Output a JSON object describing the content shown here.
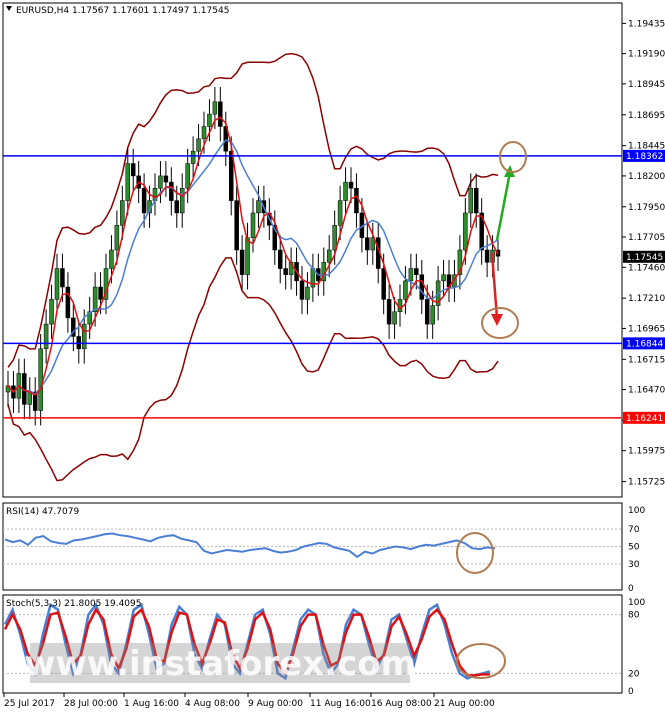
{
  "chart_data": {
    "type": "candlestick",
    "symbol_header": "EURUSD,H4  1.17567 1.17601 1.17497 1.17545",
    "ylim": [
      1.156,
      1.196
    ],
    "y_ticks": [
      "1.19435",
      "1.19190",
      "1.18945",
      "1.18695",
      "1.18445",
      "1.18200",
      "1.17950",
      "1.17705",
      "1.17460",
      "1.17210",
      "1.16965",
      "1.16715",
      "1.16470",
      "1.16220",
      "1.15975",
      "1.15725"
    ],
    "x_labels": [
      "25 Jul 2017",
      "28 Jul 00:00",
      "1 Aug 16:00",
      "4 Aug 08:00",
      "9 Aug 00:00",
      "11 Aug 16:00",
      "16 Aug 08:00",
      "21 Aug 00:00"
    ],
    "close_series": [
      1.165,
      1.164,
      1.166,
      1.1635,
      1.1645,
      1.163,
      1.168,
      1.17,
      1.172,
      1.1745,
      1.173,
      1.1705,
      1.169,
      1.168,
      1.17,
      1.171,
      1.173,
      1.172,
      1.1745,
      1.176,
      1.178,
      1.18,
      1.183,
      1.182,
      1.181,
      1.179,
      1.18,
      1.181,
      1.182,
      1.1815,
      1.18,
      1.179,
      1.181,
      1.183,
      1.184,
      1.185,
      1.186,
      1.187,
      1.188,
      1.186,
      1.184,
      1.18,
      1.176,
      1.174,
      1.177,
      1.179,
      1.18,
      1.179,
      1.178,
      1.176,
      1.1745,
      1.174,
      1.175,
      1.1735,
      1.172,
      1.173,
      1.1745,
      1.1735,
      1.175,
      1.176,
      1.178,
      1.18,
      1.1815,
      1.181,
      1.179,
      1.177,
      1.176,
      1.177,
      1.1745,
      1.172,
      1.17,
      1.171,
      1.172,
      1.1735,
      1.1745,
      1.174,
      1.172,
      1.17,
      1.1715,
      1.1735,
      1.174,
      1.173,
      1.174,
      1.176,
      1.179,
      1.181,
      1.179,
      1.176,
      1.175,
      1.176,
      1.1755
    ],
    "horizontal_levels": [
      {
        "value": 1.18362,
        "label": "1.18362",
        "color": "#0000ff"
      },
      {
        "value": 1.16844,
        "label": "1.16844",
        "color": "#0000ff"
      },
      {
        "value": 1.16241,
        "label": "1.16241",
        "color": "#ff0000"
      }
    ],
    "current_price": {
      "value": 1.17545,
      "label": "1.17545"
    },
    "rsi": {
      "header": "RSI(14) 47.7079",
      "ylim": [
        0,
        100
      ],
      "ticks": [
        "100",
        "70",
        "50",
        "30",
        "0"
      ],
      "values": [
        58,
        55,
        57,
        52,
        60,
        62,
        56,
        54,
        53,
        57,
        58,
        60,
        62,
        64,
        65,
        63,
        62,
        60,
        58,
        56,
        60,
        62,
        63,
        59,
        57,
        55,
        45,
        42,
        44,
        46,
        45,
        44,
        46,
        47,
        48,
        45,
        43,
        44,
        46,
        50,
        52,
        54,
        53,
        49,
        47,
        45,
        38,
        44,
        42,
        46,
        48,
        50,
        49,
        47,
        50,
        52,
        51,
        53,
        55,
        57,
        54,
        48,
        47,
        49,
        48
      ]
    },
    "stoch": {
      "header": "Stoch(5,3,3) 21.8005 19.4095",
      "ylim": [
        0,
        100
      ],
      "ticks": [
        "100",
        "80",
        "20",
        "0"
      ],
      "k": [
        70,
        85,
        60,
        30,
        20,
        60,
        90,
        85,
        50,
        20,
        40,
        80,
        90,
        70,
        30,
        20,
        50,
        85,
        90,
        60,
        25,
        30,
        70,
        88,
        80,
        40,
        25,
        55,
        80,
        70,
        30,
        20,
        50,
        80,
        85,
        60,
        20,
        15,
        45,
        75,
        85,
        80,
        40,
        20,
        30,
        70,
        85,
        80,
        50,
        25,
        40,
        75,
        80,
        55,
        30,
        60,
        85,
        90,
        70,
        40,
        20,
        15,
        18,
        20,
        22
      ],
      "d": [
        65,
        80,
        65,
        40,
        28,
        50,
        80,
        82,
        58,
        30,
        38,
        70,
        85,
        75,
        40,
        25,
        45,
        78,
        85,
        68,
        35,
        32,
        62,
        82,
        80,
        50,
        30,
        50,
        75,
        72,
        40,
        25,
        45,
        75,
        82,
        65,
        30,
        20,
        40,
        68,
        80,
        80,
        50,
        28,
        32,
        62,
        80,
        80,
        58,
        32,
        38,
        68,
        78,
        60,
        38,
        55,
        78,
        85,
        75,
        50,
        28,
        18,
        18,
        19,
        19
      ]
    },
    "watermark": "www.instaforex.com"
  }
}
